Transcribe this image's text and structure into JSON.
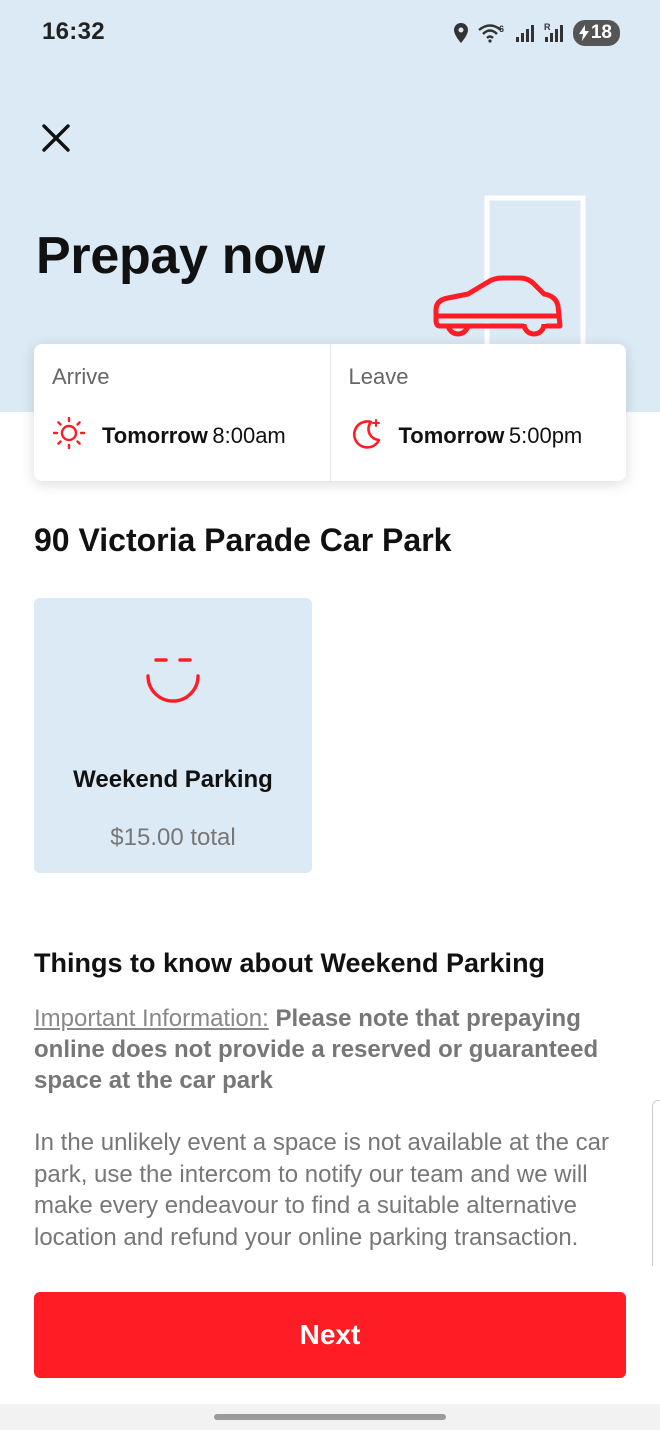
{
  "status_bar": {
    "time": "16:32",
    "battery": "18",
    "icons": [
      "location-icon",
      "wifi-icon",
      "signal-icon",
      "signal-roaming-icon",
      "battery-charging-icon"
    ]
  },
  "header": {
    "close_icon": "close-icon",
    "title": "Prepay now"
  },
  "schedule": {
    "arrive": {
      "label": "Arrive",
      "day": "Tomorrow",
      "time": "8:00am",
      "icon": "sun-icon"
    },
    "leave": {
      "label": "Leave",
      "day": "Tomorrow",
      "time": "5:00pm",
      "icon": "moon-icon"
    }
  },
  "carpark": {
    "name": "90 Victoria Parade Car Park"
  },
  "options": [
    {
      "title": "Weekend Parking",
      "price": "$15.00 total",
      "icon": "smiley-icon"
    }
  ],
  "info": {
    "heading": "Things to know about Weekend Parking",
    "important_link": "Important Information:",
    "important_text": "Please note that prepaying online does not provide a reserved or guaranteed space at the car park",
    "body": "In the unlikely event a space is not available at the car park, use the intercom to notify our team and we will make every endeavour to find a suitable alternative location and refund your online parking transaction."
  },
  "actions": {
    "next_label": "Next"
  },
  "colors": {
    "accent": "#ff1d25",
    "hero_bg": "#dceaf5",
    "muted_text": "#777777"
  }
}
